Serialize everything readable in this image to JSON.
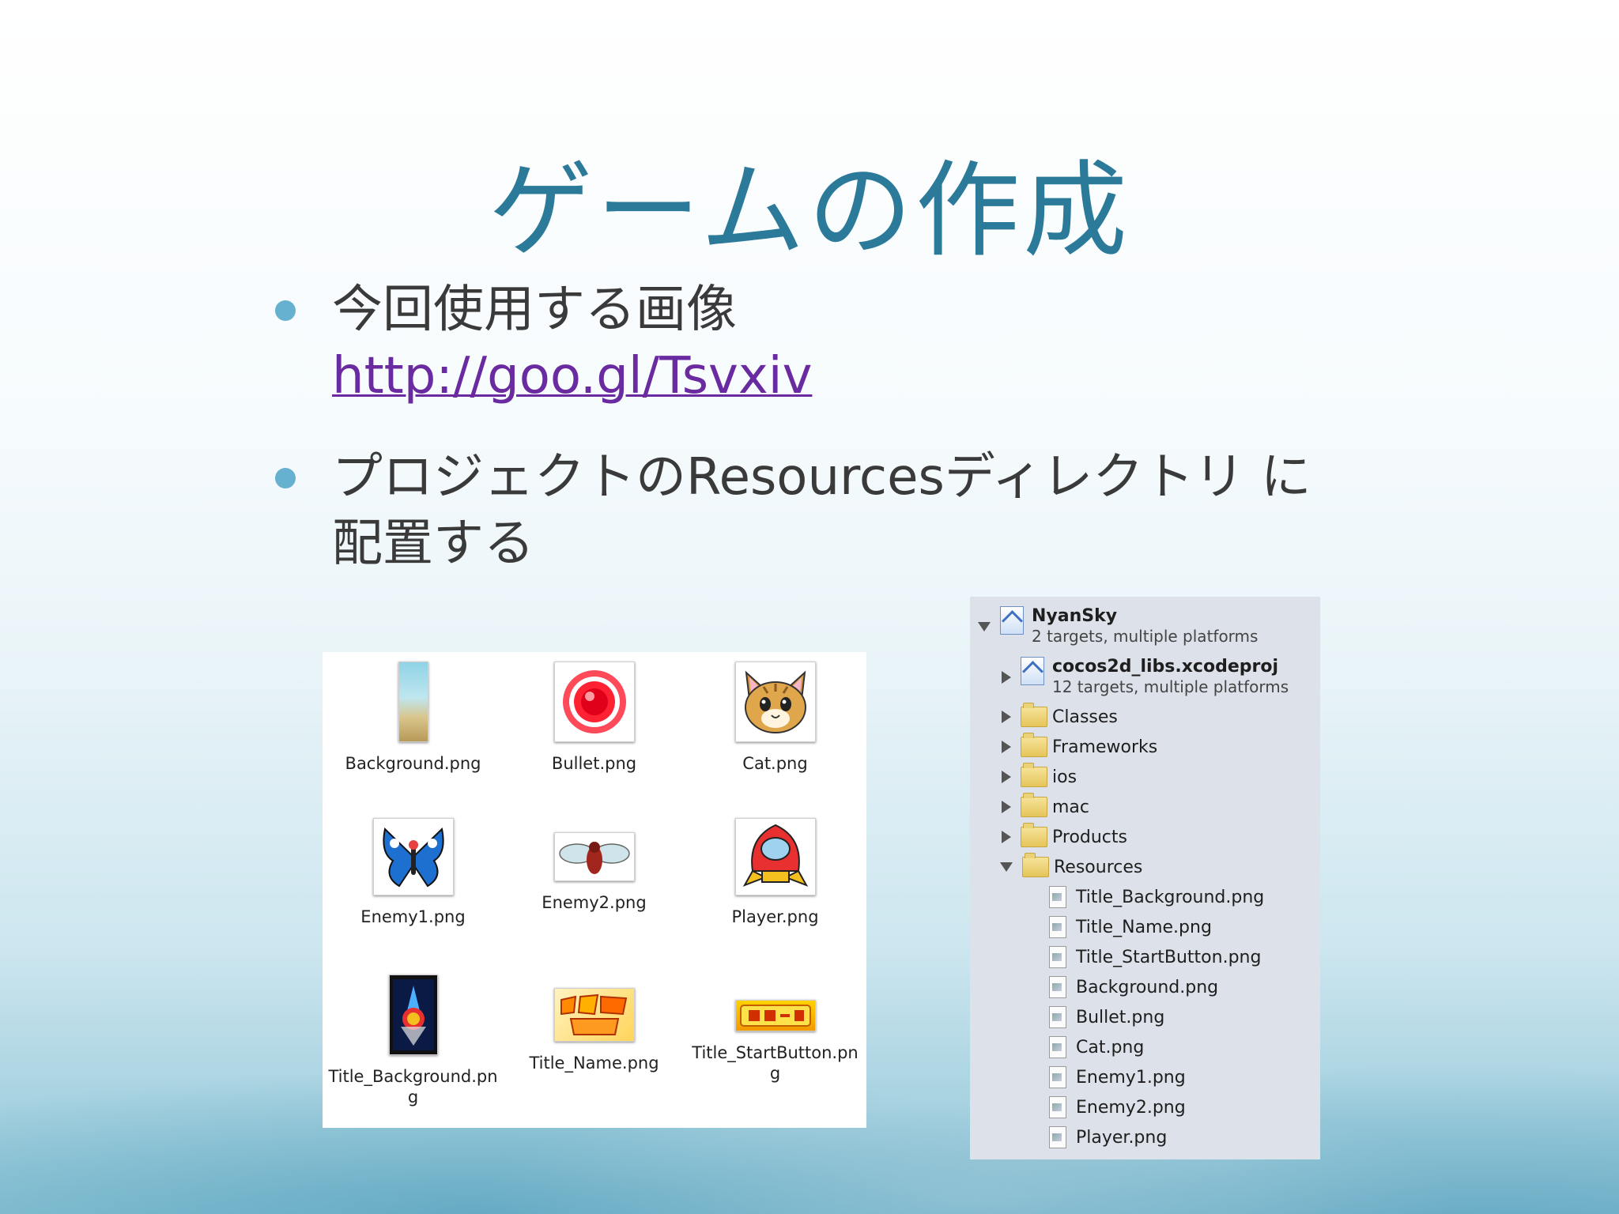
{
  "slide": {
    "title": "ゲームの作成",
    "bullets": [
      {
        "text": "今回使用する画像",
        "link": "http://goo.gl/Tsvxiv"
      },
      {
        "text": "プロジェクトのResourcesディレクトリ に配置する"
      }
    ]
  },
  "finder": {
    "files": [
      {
        "name": "Background.png"
      },
      {
        "name": "Bullet.png"
      },
      {
        "name": "Cat.png"
      },
      {
        "name": "Enemy1.png"
      },
      {
        "name": "Enemy2.png"
      },
      {
        "name": "Player.png"
      },
      {
        "name": "Title_Background.png"
      },
      {
        "name": "Title_Name.png"
      },
      {
        "name": "Title_StartButton.png"
      }
    ]
  },
  "navigator": {
    "project": {
      "name": "NyanSky",
      "sub": "2 targets, multiple platforms"
    },
    "subproject": {
      "name": "cocos2d_libs.xcodeproj",
      "sub": "12 targets, multiple platforms"
    },
    "groups": [
      "Classes",
      "Frameworks",
      "ios",
      "mac",
      "Products",
      "Resources"
    ],
    "resources": [
      "Title_Background.png",
      "Title_Name.png",
      "Title_StartButton.png",
      "Background.png",
      "Bullet.png",
      "Cat.png",
      "Enemy1.png",
      "Enemy2.png",
      "Player.png"
    ]
  },
  "colors": {
    "title": "#2b7a9a",
    "bullet_dot": "#66b0d0",
    "link": "#6a2aa0"
  }
}
